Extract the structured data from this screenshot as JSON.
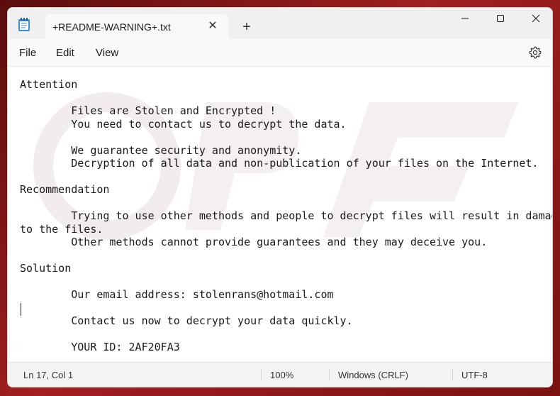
{
  "tab": {
    "title": "+README-WARNING+.txt"
  },
  "menu": {
    "file": "File",
    "edit": "Edit",
    "view": "View"
  },
  "editor": {
    "lines": [
      "Attention",
      "",
      "        Files are Stolen and Encrypted !",
      "        You need to contact us to decrypt the data.",
      "",
      "        We guarantee security and anonymity.",
      "        Decryption of all data and non-publication of your files on the Internet.",
      "",
      "Recommendation",
      "",
      "        Trying to use other methods and people to decrypt files will result in damage",
      "to the files.",
      "        Other methods cannot provide guarantees and they may deceive you.",
      "",
      "Solution",
      "",
      "        Our email address: stolenrans@hotmail.com",
      "",
      "        Contact us now to decrypt your data quickly.",
      "",
      "        YOUR ID: 2AF20FA3"
    ]
  },
  "status": {
    "position": "Ln 17, Col 1",
    "zoom": "100%",
    "line_ending": "Windows (CRLF)",
    "encoding": "UTF-8"
  },
  "icons": {
    "app": "notepad-icon",
    "tab_close": "close-icon",
    "new_tab": "plus-icon",
    "minimize": "minimize-icon",
    "maximize": "maximize-icon",
    "close": "close-icon",
    "settings": "gear-icon"
  }
}
